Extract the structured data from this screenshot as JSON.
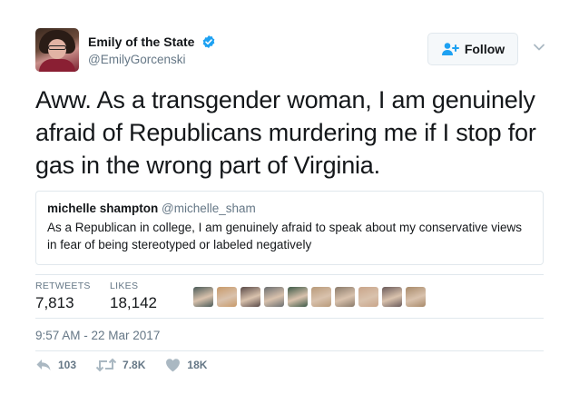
{
  "author": {
    "display_name": "Emily of the State",
    "handle": "@EmilyGorcenski",
    "verified": true
  },
  "follow_button": {
    "label": "Follow"
  },
  "tweet": {
    "text": "Aww. As a transgender woman, I am genuinely afraid of Republicans murdering me if I stop for gas in the wrong part of Virginia."
  },
  "quoted_tweet": {
    "display_name": "michelle shampton",
    "handle": "@michelle_sham",
    "text": "As a Republican in college, I am genuinely afraid to speak about my conservative views in fear of being stereotyped or labeled negatively"
  },
  "stats": {
    "retweets_label": "RETWEETS",
    "retweets_value": "7,813",
    "likes_label": "LIKES",
    "likes_value": "18,142"
  },
  "liker_avatars": [
    "#4a5a58",
    "#c89a6a",
    "#5a4a48",
    "#6a6e70",
    "#3e5a48",
    "#b89a7a",
    "#8a7a6a",
    "#c9a58a",
    "#6a5a5a",
    "#a88a6a"
  ],
  "timestamp": "9:57 AM - 22 Mar 2017",
  "actions": {
    "reply_count": "103",
    "retweet_count": "7.8K",
    "like_count": "18K"
  },
  "colors": {
    "verified_blue": "#1da1f2",
    "follow_icon_blue": "#1da1f2",
    "muted_gray": "#657786"
  }
}
